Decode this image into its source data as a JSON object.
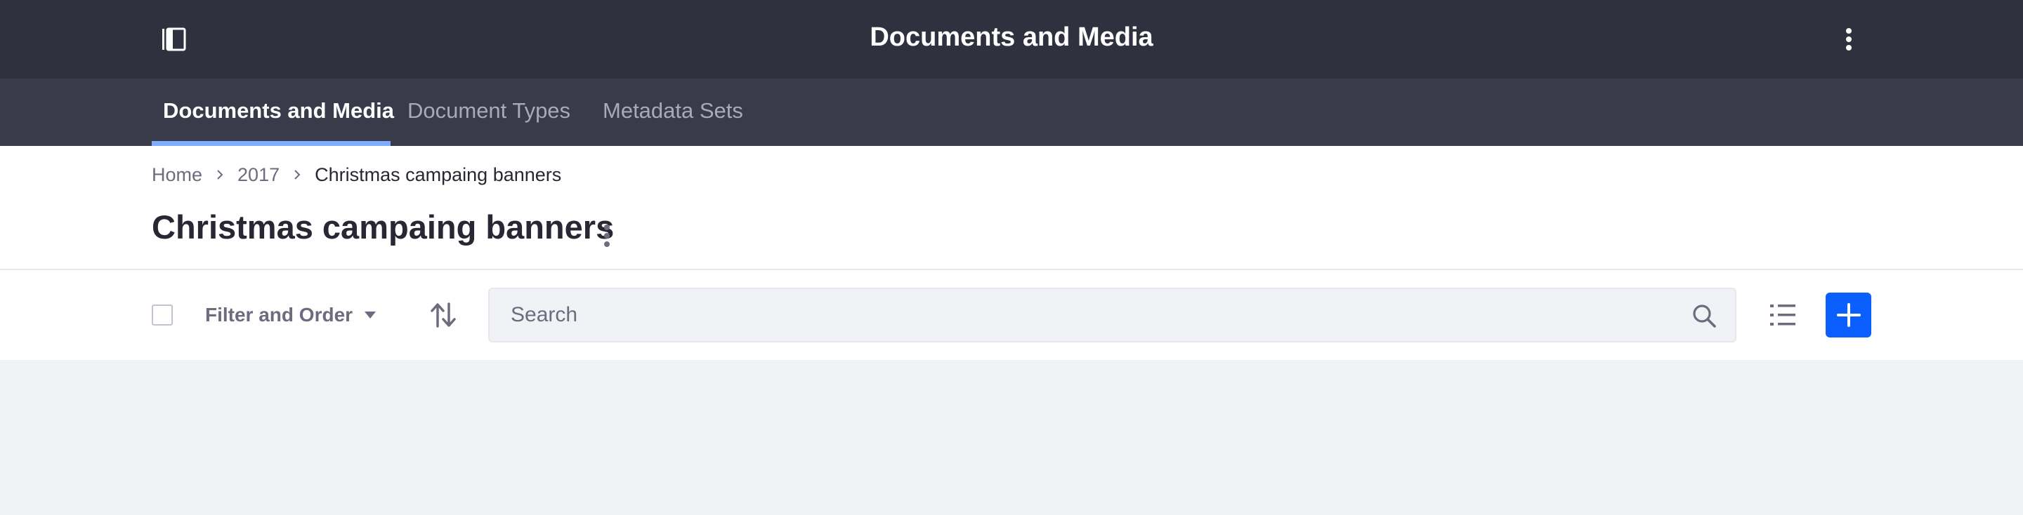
{
  "app": {
    "title": "Documents and Media"
  },
  "nav": {
    "tabs": [
      {
        "label": "Documents and Media",
        "active": true
      },
      {
        "label": "Document Types",
        "active": false
      },
      {
        "label": "Metadata Sets",
        "active": false
      }
    ]
  },
  "breadcrumb": {
    "items": [
      "Home",
      "2017"
    ],
    "current": "Christmas campaing banners"
  },
  "page": {
    "title": "Christmas campaing banners"
  },
  "toolbar": {
    "filter_label": "Filter and Order",
    "search_placeholder": "Search"
  },
  "colors": {
    "topbar": "#30313f",
    "navbar": "#393a4a",
    "active_tab_underline": "#80acff",
    "primary": "#0b5fff",
    "background": "#f1f2f5"
  },
  "icons": {
    "sidebar_toggle": "product-menu-icon",
    "app_menu": "ellipsis-vertical-icon",
    "breadcrumb_separator": "angle-right-icon",
    "page_actions": "ellipsis-vertical-icon",
    "filter_caret": "caret-bottom-icon",
    "sort": "order-arrow-icon",
    "search": "search-icon",
    "display_style": "list-icon",
    "add": "plus-icon"
  }
}
